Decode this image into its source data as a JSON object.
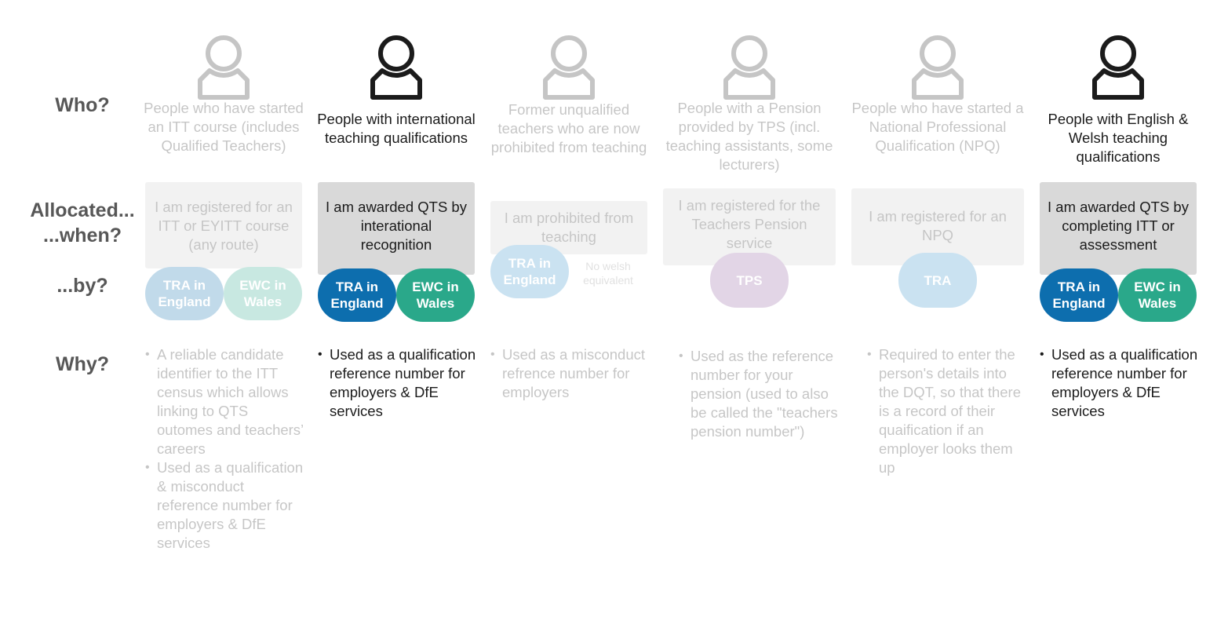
{
  "row_labels": {
    "who": "Who?",
    "allocated": "Allocated...",
    "when": "...when?",
    "by": "...by?",
    "why": "Why?"
  },
  "columns": [
    {
      "who": "People who have started an ITT course (includes Qualified Teachers)",
      "when": "I am registered for an ITT or EYITT course (any route)",
      "by": [
        "TRA in England",
        "EWC in Wales"
      ],
      "why": [
        "A reliable candidate identifier to the ITT census which allows linking to QTS outomes and teachers’ careers",
        "Used as a qualification & misconduct reference number for employers  & DfE services"
      ]
    },
    {
      "who": "People with international teaching qualifications",
      "when": "I am awarded QTS by interational recognition",
      "by": [
        "TRA in England",
        "EWC in Wales"
      ],
      "why": [
        "Used as a qualification reference number for employers & DfE services"
      ]
    },
    {
      "who": "Former unqualified teachers who are now prohibited from teaching",
      "when": "I am prohibited from teaching",
      "by": [
        "TRA in England"
      ],
      "by_note": "No welsh equivalent",
      "why": [
        "Used as a misconduct refrence number for employers"
      ]
    },
    {
      "who": "People with a Pension provided by TPS (incl. teaching assistants, some lecturers)",
      "when": "I am registered for the Teachers Pension service",
      "by": [
        "TPS"
      ],
      "why": [
        "Used as the reference number for your pension (used to also be called the \"teachers pension number\")"
      ]
    },
    {
      "who": "People who have started a National Professional Qualification (NPQ)",
      "when": "I am registered for an NPQ",
      "by": [
        "TRA"
      ],
      "why": [
        "Required to enter the person's details into the DQT, so that there is a record of their quaification if an employer looks them up"
      ]
    },
    {
      "who": "People with English & Welsh teaching qualifications",
      "when": "I am awarded QTS by completing ITT or assessment",
      "by": [
        "TRA in England",
        "EWC in Wales"
      ],
      "why": [
        "Used as a qualification reference number for employers & DfE services"
      ]
    }
  ],
  "colors": {
    "tra": "#0d6eae",
    "ewc": "#2aa88a",
    "tps": "#8e5a9e",
    "box": "#d9d9d9",
    "label": "#575757",
    "icon": "#1b1b1b"
  }
}
